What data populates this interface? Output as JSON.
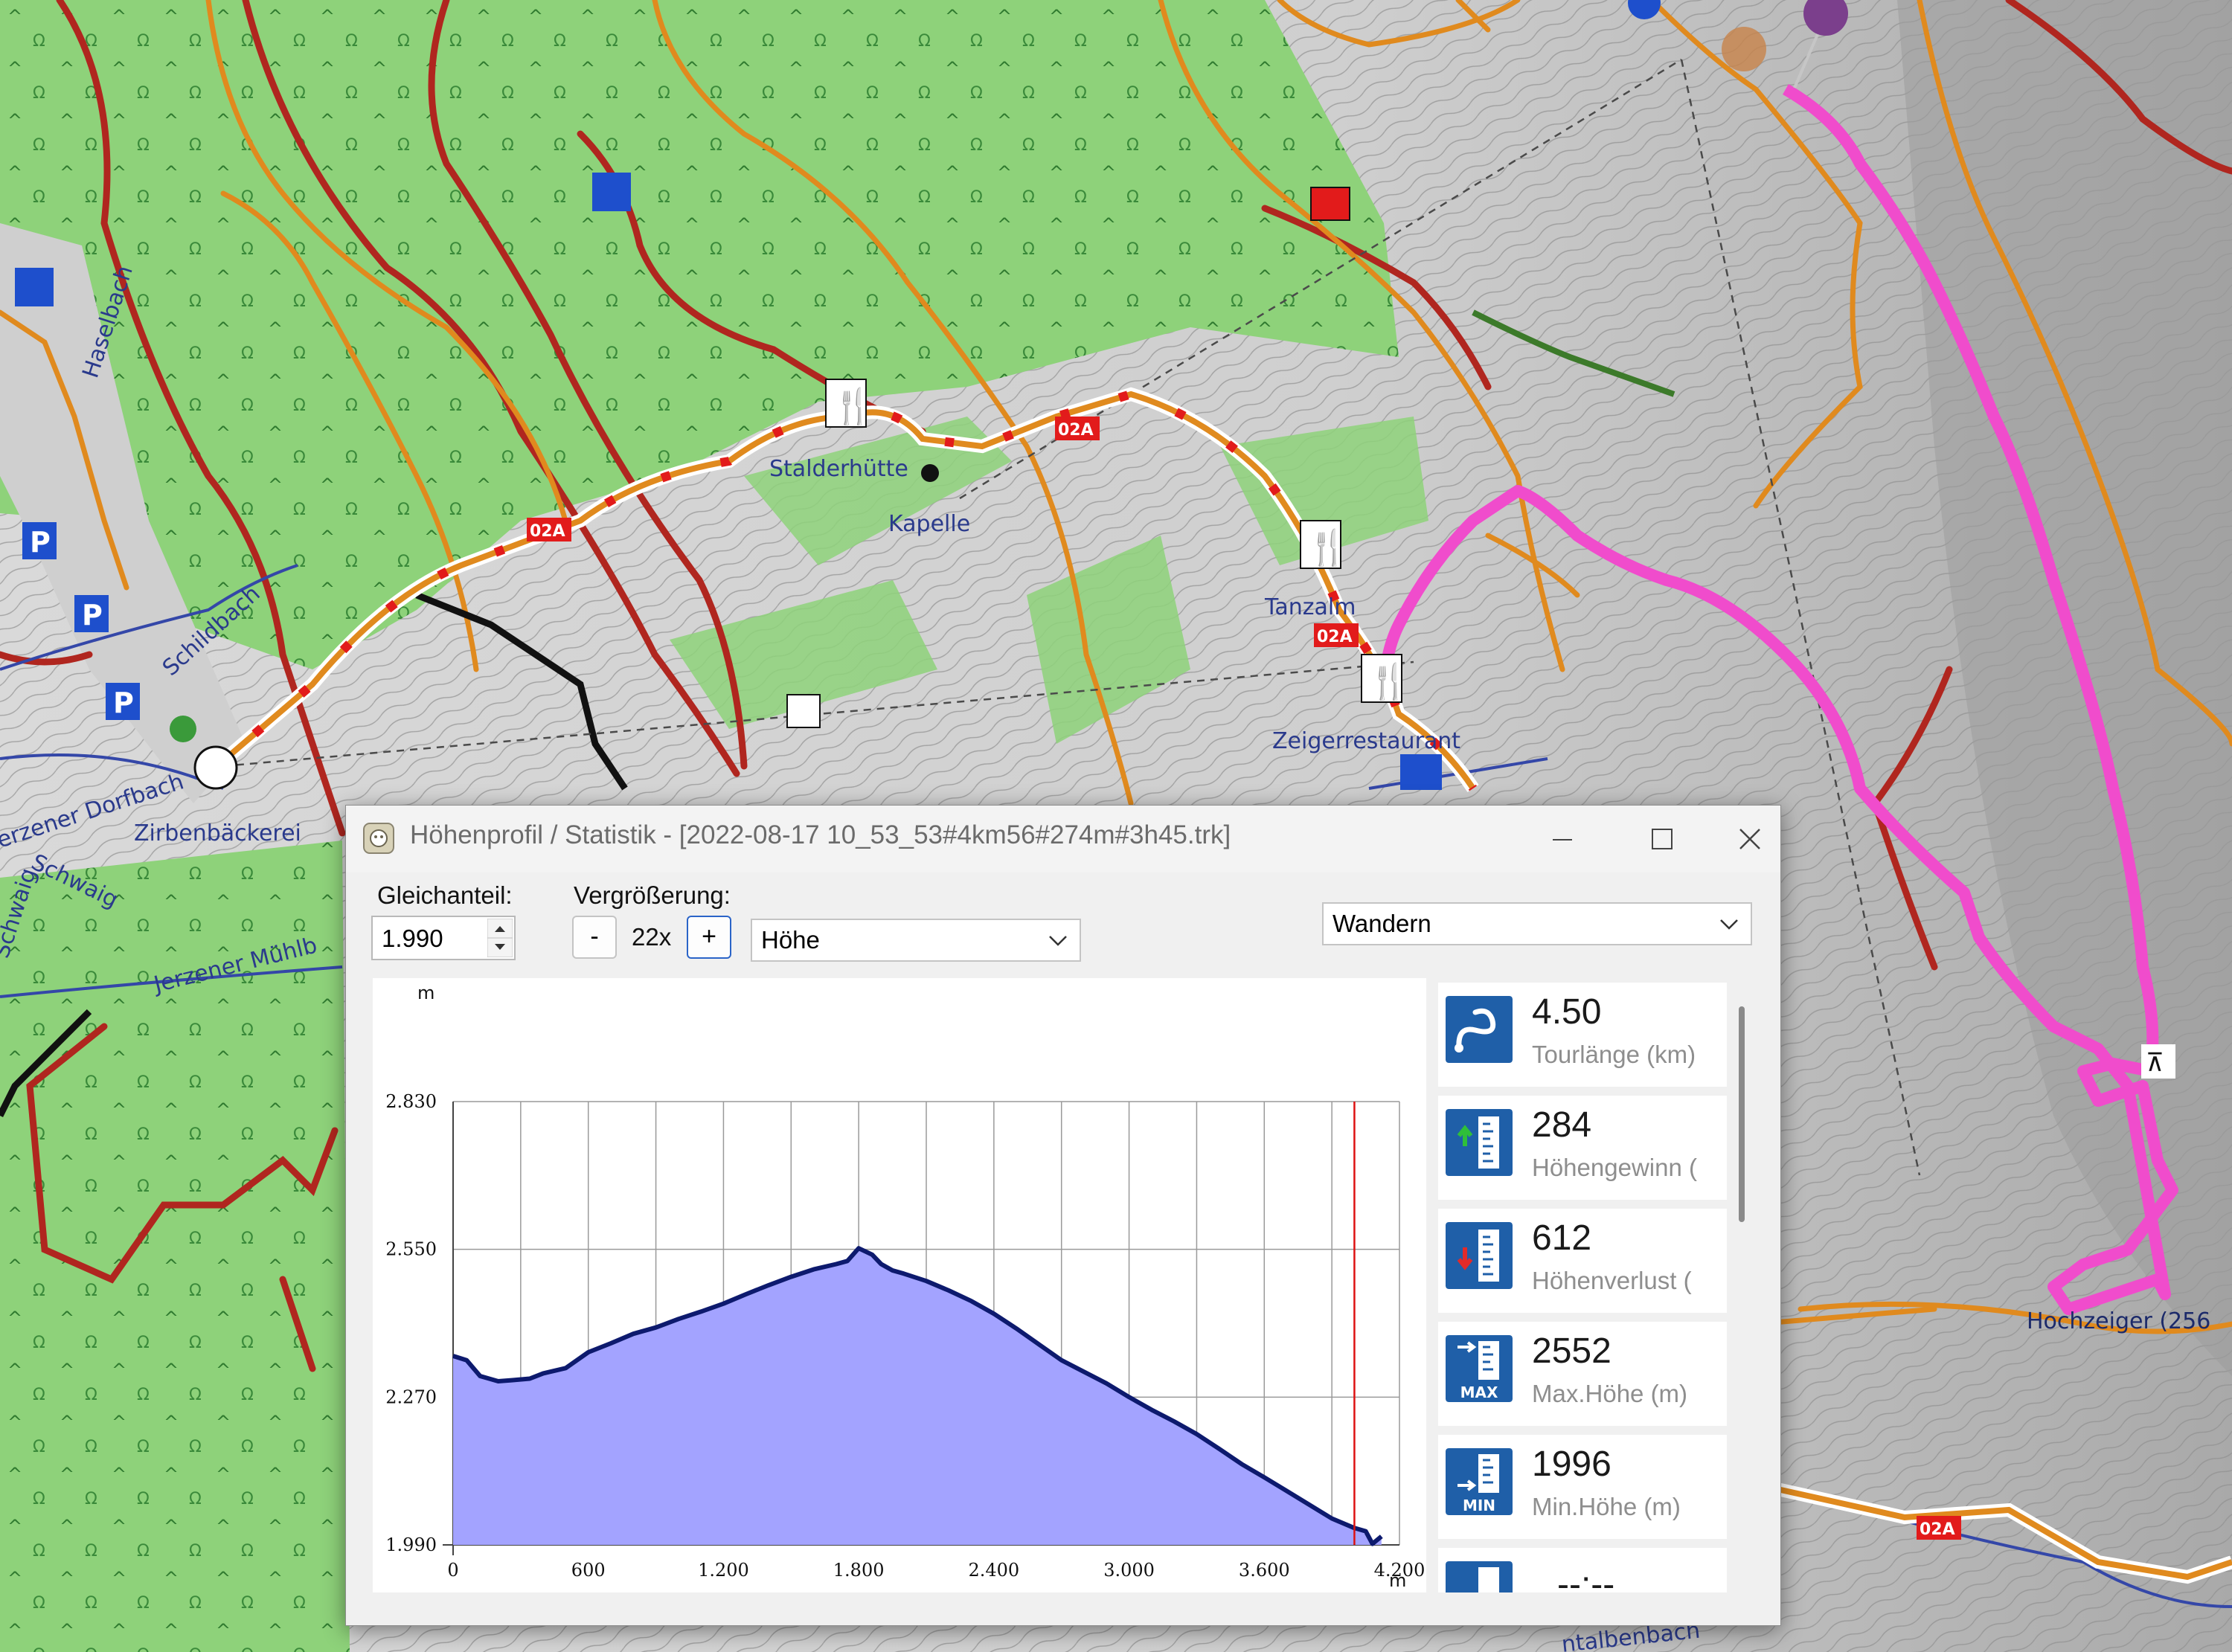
{
  "map": {
    "labels": {
      "stalderhuette": "Stalderhütte",
      "kapelle": "Kapelle",
      "tanzalm": "Tanzalm",
      "zeigerrestaurant": "Zeigerrestaurant",
      "zirbenbaeckerei": "Zirbenbäckerei",
      "hochzeiger": "Hochzeiger (256",
      "schildbach": "Schildbach",
      "haselbach": "Haselbach",
      "dorfbach": "erzener Dorfbach",
      "schwaig1": "Schwaig",
      "schwaig2": "Schwaig",
      "muehlbach": "Jerzener Mühlb",
      "bachbottom": "ntalbenbach",
      "trail1": "02A",
      "trail2": "02A",
      "trail3": "02A",
      "trail4": "02A"
    },
    "colors": {
      "track": "#f04ccc",
      "forest": "#8ed27a",
      "path_orange": "#e08a1e",
      "path_red": "#b0261f"
    }
  },
  "window": {
    "title": "Höhenprofil / Statistik - [2022-08-17 10_53_53#4km56#274m#3h45.trk]",
    "gleichanteil_label": "Gleichanteil:",
    "gleichanteil_value": "1.990",
    "zoom_label": "Vergrößerung:",
    "zoom_minus": "-",
    "zoom_value": "22x",
    "zoom_plus": "+",
    "profile_select": "Höhe",
    "activity_select": "Wandern"
  },
  "chart_data": {
    "type": "area",
    "xlabel": "m",
    "ylabel": "m",
    "xlim": [
      0,
      4200
    ],
    "ylim": [
      1990,
      2830
    ],
    "xticks": [
      "0",
      "600",
      "1.200",
      "1.800",
      "2.400",
      "3.000",
      "3.600",
      "4.200"
    ],
    "yticks": [
      "1.990",
      "2.270",
      "2.550",
      "2.830"
    ],
    "marker_x": 4000,
    "grid": true,
    "line_color": "#0d1a6e",
    "fill_color": "#a3a3ff",
    "marker_color": "#dd1111",
    "series": [
      {
        "x": [
          0,
          60,
          120,
          200,
          260,
          340,
          400,
          500,
          600,
          700,
          800,
          900,
          1000,
          1100,
          1200,
          1300,
          1400,
          1500,
          1600,
          1700,
          1750,
          1800,
          1860,
          1900,
          1950,
          2000,
          2100,
          2200,
          2300,
          2400,
          2500,
          2600,
          2700,
          2800,
          2900,
          3000,
          3100,
          3200,
          3300,
          3400,
          3500,
          3600,
          3700,
          3800,
          3900,
          4000,
          4050,
          4080,
          4120
        ],
        "y": [
          2348,
          2340,
          2310,
          2300,
          2302,
          2305,
          2315,
          2325,
          2355,
          2372,
          2390,
          2402,
          2418,
          2432,
          2447,
          2465,
          2482,
          2498,
          2512,
          2522,
          2528,
          2552,
          2540,
          2522,
          2510,
          2504,
          2490,
          2472,
          2452,
          2428,
          2400,
          2370,
          2340,
          2318,
          2296,
          2270,
          2246,
          2224,
          2200,
          2172,
          2143,
          2118,
          2092,
          2066,
          2040,
          2022,
          2016,
          1992,
          2006
        ]
      }
    ]
  },
  "stats": [
    {
      "value": "4.50",
      "caption": "Tourlänge (km)",
      "icon": "route-length-icon"
    },
    {
      "value": "284",
      "caption": "Höhengewinn (",
      "icon": "elevation-gain-icon"
    },
    {
      "value": "612",
      "caption": "Höhenverlust (",
      "icon": "elevation-loss-icon"
    },
    {
      "value": "2552",
      "caption": "Max.Höhe (m)",
      "icon": "max-height-icon",
      "badge": "MAX"
    },
    {
      "value": "1996",
      "caption": "Min.Höhe (m)",
      "icon": "min-height-icon",
      "badge": "MIN"
    },
    {
      "value": "--:--",
      "caption": "",
      "icon": "duration-icon"
    }
  ]
}
